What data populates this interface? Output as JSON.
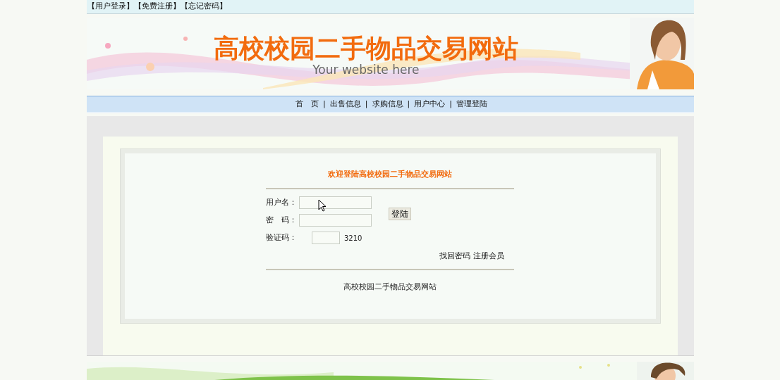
{
  "top_links": [
    "【用户登录】",
    "【免费注册】",
    "【忘记密码】"
  ],
  "banner": {
    "title": "高校校园二手物品交易网站",
    "subtitle": "Your website here"
  },
  "nav": {
    "separator": "|",
    "items": [
      "首　页",
      "出售信息",
      "求购信息",
      "用户中心",
      "管理登陆"
    ]
  },
  "login": {
    "heading": "欢迎登陆高校校园二手物品交易网站",
    "fields": [
      {
        "label": "用户名："
      },
      {
        "label": "密　码："
      }
    ],
    "captcha": {
      "label": "验证码：",
      "code": "3210"
    },
    "button": "登陆",
    "links": [
      "找回密码",
      "注册会员"
    ],
    "footer": "高校校园二手物品交易网站"
  }
}
